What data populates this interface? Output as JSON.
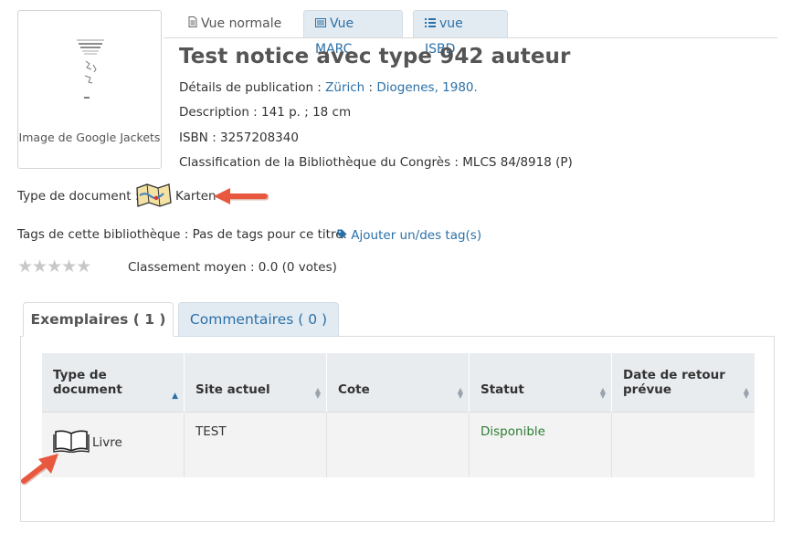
{
  "view_tabs": {
    "normal": "Vue normale",
    "marc": "Vue MARC",
    "isbd": "vue ISBD"
  },
  "cover": {
    "caption": "Image de Google Jackets"
  },
  "record": {
    "title": "Test notice avec type 942 auteur",
    "publication_label": "Détails de publication : ",
    "publication_place": "Zürich",
    "publication_sep": " : ",
    "publisher": "Diogenes, 1980.",
    "description": "Description : 141 p. ; 18 cm",
    "isbn": "ISBN : 3257208340",
    "lcc": "Classification de la Bibliothèque du Congrès : MLCS 84/8918 (P)",
    "doc_type_label": "Type de document : ",
    "doc_type_value": "Karten",
    "tags_label": "Tags de cette bibliothèque : Pas de tags pour ce titre.",
    "add_tags": "Ajouter un/des tag(s)",
    "rating_text": "Classement moyen : 0.0 (0 votes)",
    "rating_value": 0,
    "rating_max": 5
  },
  "item_tabs": {
    "holdings": "Exemplaires ( 1 )",
    "comments": "Commentaires ( 0 )"
  },
  "table": {
    "headers": {
      "type_line1": "Type de",
      "type_line2": "document",
      "site": "Site actuel",
      "cote": "Cote",
      "status": "Statut",
      "due_line1": "Date de retour",
      "due_line2": "prévue"
    },
    "rows": [
      {
        "type": "Livre",
        "site": "TEST",
        "cote": "",
        "status": "Disponible",
        "due": ""
      }
    ]
  },
  "colors": {
    "link": "#2a70a8",
    "available": "#2e7d32",
    "arrow": "#e8583f"
  },
  "icons": [
    "file-icon",
    "list-icon",
    "list-icon",
    "map-icon",
    "tag-icon",
    "star-icon",
    "book-icon",
    "arrow-icon"
  ]
}
